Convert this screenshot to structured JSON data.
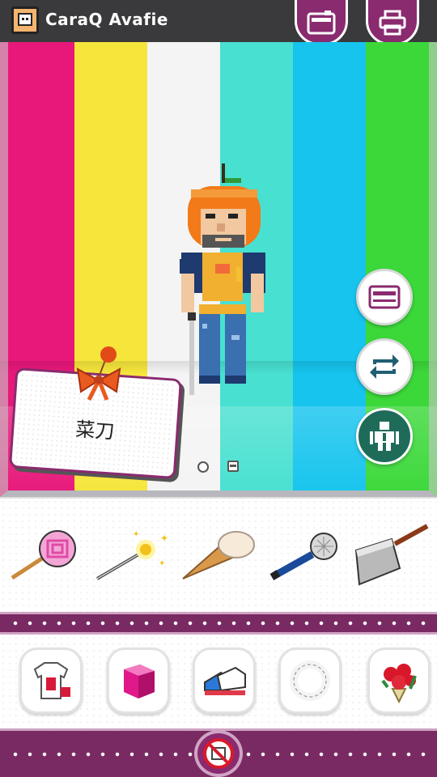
{
  "app": {
    "title": "CaraQ Avafie",
    "logo_icon": "avatar-face-icon"
  },
  "toolbar": {
    "outfit_icon": "wardrobe-icon",
    "share_icon": "printer-icon"
  },
  "stage": {
    "stripe_colors": [
      "#e8187a",
      "#f6e63c",
      "#f4f4f4",
      "#48e0d0",
      "#16c4ee",
      "#3cd83a"
    ],
    "selected_item_name": "菜刀",
    "side_buttons": [
      "wardrobe-icon",
      "swap-icon",
      "character-icon"
    ],
    "pager_icons": [
      "page-dot-icon",
      "save-icon"
    ]
  },
  "items_top": [
    {
      "name": "lollipop-icon"
    },
    {
      "name": "magic-wand-icon"
    },
    {
      "name": "ice-cream-cone-icon"
    },
    {
      "name": "microphone-icon"
    },
    {
      "name": "cleaver-icon"
    }
  ],
  "items_bottom": [
    {
      "name": "top-clothing-category-icon"
    },
    {
      "name": "bottom-clothing-category-icon"
    },
    {
      "name": "shoes-category-icon"
    },
    {
      "name": "accessory-category-icon"
    },
    {
      "name": "hand-item-category-icon"
    }
  ],
  "footer": {
    "no_ads_icon": "no-ads-icon"
  },
  "colors": {
    "accent": "#8a2a6f",
    "topbar": "#3a3a3c"
  }
}
